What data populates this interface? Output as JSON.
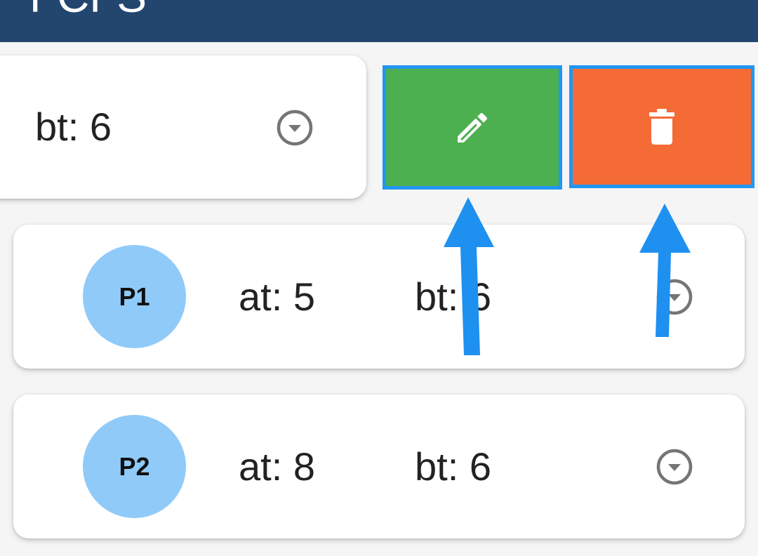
{
  "appbar": {
    "title": "FCFS",
    "color": "#23466f"
  },
  "swiped_item": {
    "bt_label": "bt: 6",
    "actions": {
      "edit": {
        "icon": "pencil-icon",
        "color": "#4caf50"
      },
      "delete": {
        "icon": "trash-icon",
        "color": "#f46b36"
      },
      "highlight_color": "#2196f3"
    }
  },
  "processes": [
    {
      "name": "P1",
      "at_label": "at: 5",
      "bt_label": "bt: 6"
    },
    {
      "name": "P2",
      "at_label": "at: 8",
      "bt_label": "bt: 6"
    }
  ],
  "icons": {
    "expand": "chevron-down-circle-icon",
    "annotation": "arrow-up-icon"
  },
  "colors": {
    "avatar": "#90caf9",
    "annotation_arrow": "#1e90f0"
  }
}
